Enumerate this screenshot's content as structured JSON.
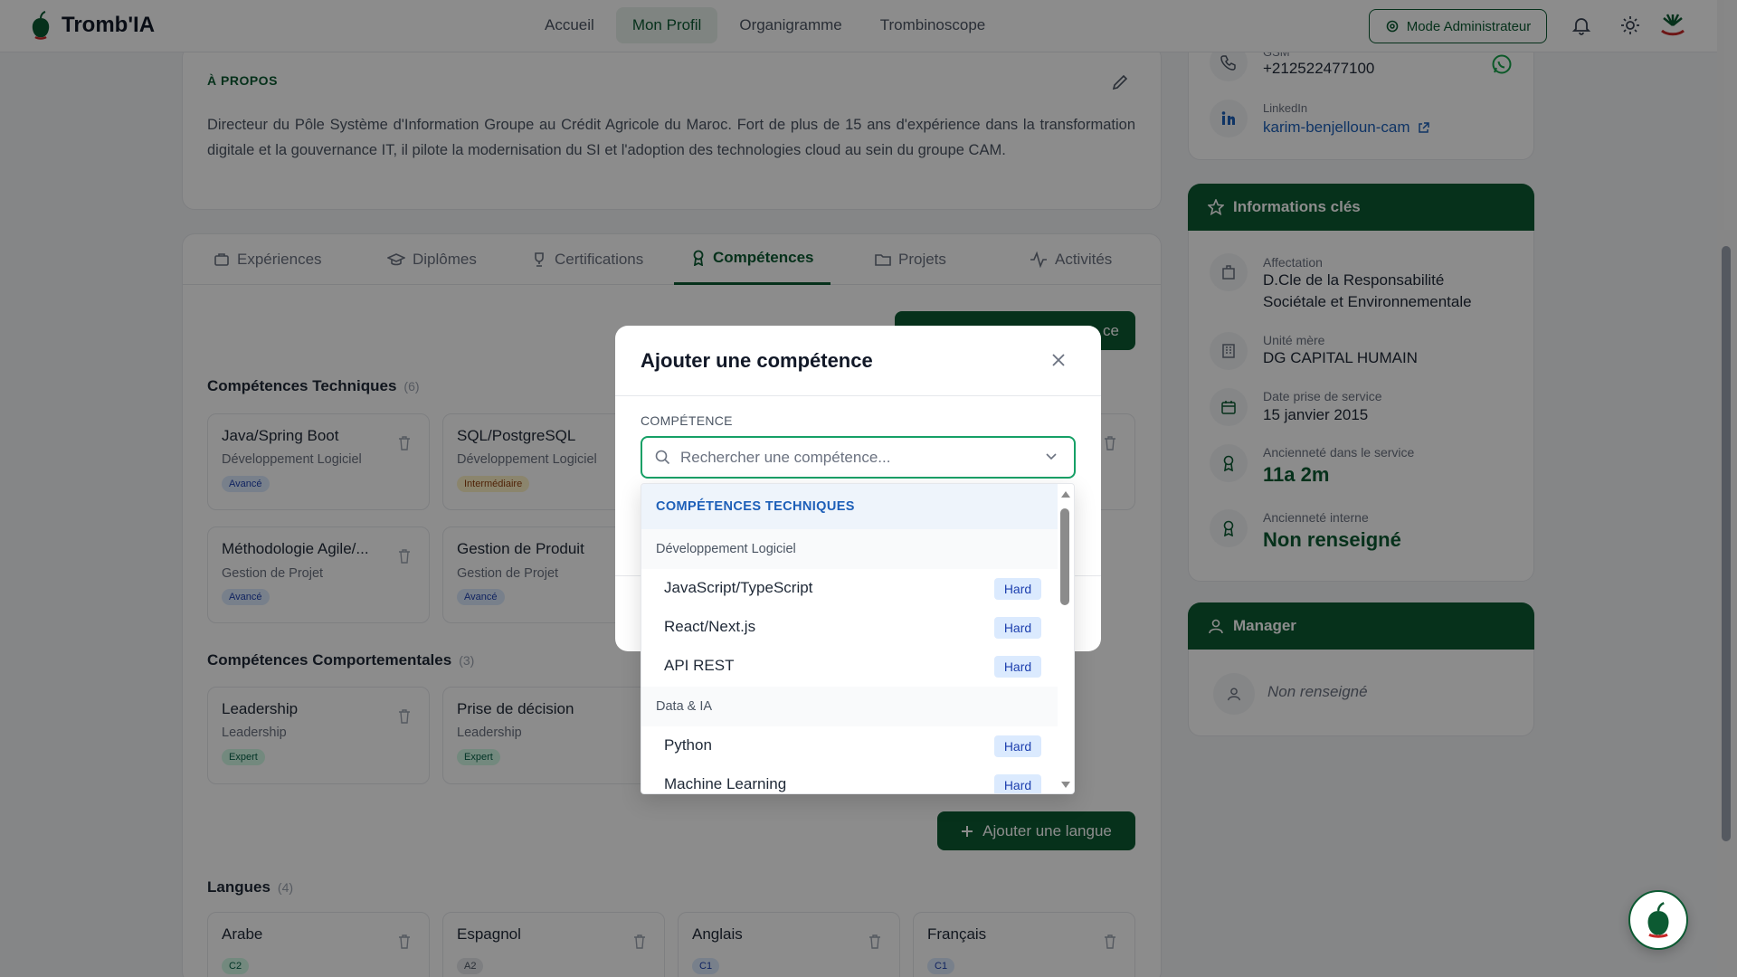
{
  "app": {
    "name": "Tromb'IA"
  },
  "nav": {
    "items": [
      "Accueil",
      "Mon Profil",
      "Organigramme",
      "Trombinoscope"
    ]
  },
  "header": {
    "admin_label": "Mode Administrateur"
  },
  "about": {
    "title": "À PROPOS",
    "text": "Directeur du Pôle Système d'Information Groupe au Crédit Agricole du Maroc. Fort de plus de 15 ans d'expérience dans la transformation digitale et la gouvernance IT, il pilote la modernisation du SI et l'adoption des technologies cloud au sein du groupe CAM."
  },
  "tabs": [
    "Expériences",
    "Diplômes",
    "Certifications",
    "Compétences",
    "Projets",
    "Activités"
  ],
  "skills": {
    "add_button_partial": "ce",
    "technical": {
      "title": "Compétences Techniques",
      "count": "(6)",
      "items": [
        {
          "name": "Java/Spring Boot",
          "category": "Développement Logiciel",
          "level": "Avancé"
        },
        {
          "name": "SQL/PostgreSQL",
          "category": "Développement Logiciel",
          "level": "Intermédiaire"
        },
        {
          "name": "Méthodologie Agile/...",
          "category": "Gestion de Projet",
          "level": "Avancé"
        },
        {
          "name": "Gestion de Produit",
          "category": "Gestion de Projet",
          "level": "Avancé"
        }
      ]
    },
    "behavioral": {
      "title": "Compétences Comportementales",
      "count": "(3)",
      "items": [
        {
          "name": "Leadership",
          "category": "Leadership",
          "level": "Expert"
        },
        {
          "name": "Prise de décision",
          "category": "Leadership",
          "level": "Expert"
        }
      ]
    },
    "languages": {
      "title": "Langues",
      "count": "(4)",
      "add_label": "Ajouter une langue",
      "items": [
        {
          "name": "Arabe",
          "level": "C2"
        },
        {
          "name": "Espagnol",
          "level": "A2"
        },
        {
          "name": "Anglais",
          "level": "C1"
        },
        {
          "name": "Français",
          "level": "C1"
        }
      ]
    }
  },
  "contact": {
    "phone_label": "GSM",
    "phone": "+212522477100",
    "linkedin_label": "LinkedIn",
    "linkedin": "karim-benjelloun-cam"
  },
  "key_info": {
    "title": "Informations clés",
    "affectation_label": "Affectation",
    "affectation_line1": "D.Cle de la Responsabilité",
    "affectation_line2": "Sociétale et Environnementale",
    "unite_label": "Unité mère",
    "unite": "DG CAPITAL HUMAIN",
    "date_label": "Date prise de service",
    "date": "15 janvier 2015",
    "anc_service_label": "Ancienneté dans le service",
    "anc_service": "11a 2m",
    "anc_interne_label": "Ancienneté interne",
    "anc_interne": "Non renseigné"
  },
  "manager": {
    "title": "Manager",
    "value": "Non renseigné"
  },
  "modal": {
    "title": "Ajouter une compétence",
    "field_label": "COMPÉTENCE",
    "search_placeholder": "Rechercher une compétence...",
    "dropdown": {
      "group": "COMPÉTENCES TECHNIQUES",
      "sub1": "Développement Logiciel",
      "sub1_items": [
        {
          "label": "JavaScript/TypeScript",
          "badge": "Hard"
        },
        {
          "label": "React/Next.js",
          "badge": "Hard"
        },
        {
          "label": "API REST",
          "badge": "Hard"
        }
      ],
      "sub2": "Data & IA",
      "sub2_items": [
        {
          "label": "Python",
          "badge": "Hard"
        },
        {
          "label": "Machine Learning",
          "badge": "Hard"
        }
      ]
    }
  },
  "colors": {
    "brand": "#0c5a32",
    "accent": "#16a066",
    "badge_blue": "#dbeafe"
  }
}
